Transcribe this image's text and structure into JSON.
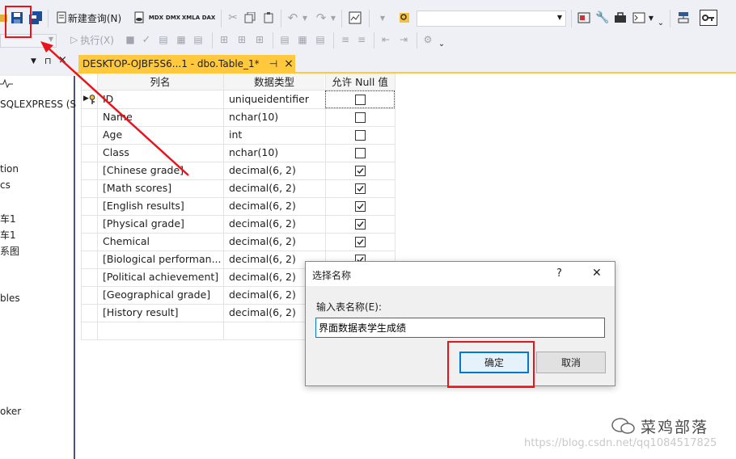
{
  "toolbar": {
    "new_query_label": "新建查询(N)",
    "mdx_label": "MDX",
    "dmx_label": "DMX",
    "xmla_label": "XMLA",
    "dax_label": "DAX",
    "execute_label": "执行(X)"
  },
  "left_panel": {
    "items": [
      "SQLEXPRESS (S",
      "tion",
      "cs",
      "车1",
      "车1",
      "系图",
      "bles",
      "oker"
    ]
  },
  "document_tab": {
    "title": "DESKTOP-OJBF5S6...1 - dbo.Table_1*",
    "pin": "⊣",
    "close": "×"
  },
  "table_designer": {
    "headers": [
      "列名",
      "数据类型",
      "允许 Null 值"
    ],
    "rows": [
      {
        "name": "ID",
        "type": "uniqueidentifier",
        "allow_null": false,
        "primary_key": true
      },
      {
        "name": "Name",
        "type": "nchar(10)",
        "allow_null": false
      },
      {
        "name": "Age",
        "type": "int",
        "allow_null": false
      },
      {
        "name": "Class",
        "type": "nchar(10)",
        "allow_null": false
      },
      {
        "name": "[Chinese grade]",
        "type": "decimal(6, 2)",
        "allow_null": true
      },
      {
        "name": "[Math scores]",
        "type": "decimal(6, 2)",
        "allow_null": true
      },
      {
        "name": "[English results]",
        "type": "decimal(6, 2)",
        "allow_null": true
      },
      {
        "name": "[Physical grade]",
        "type": "decimal(6, 2)",
        "allow_null": true
      },
      {
        "name": "Chemical",
        "type": "decimal(6, 2)",
        "allow_null": true
      },
      {
        "name": "[Biological performan...",
        "type": "decimal(6, 2)",
        "allow_null": true
      },
      {
        "name": "[Political achievement]",
        "type": "decimal(6, 2)",
        "allow_null": true
      },
      {
        "name": "[Geographical grade]",
        "type": "decimal(6, 2)",
        "allow_null": true
      },
      {
        "name": "[History result]",
        "type": "decimal(6, 2)",
        "allow_null": true
      }
    ]
  },
  "dialog": {
    "title": "选择名称",
    "help": "?",
    "close": "✕",
    "prompt": "输入表名称(E):",
    "input_value": "界面数据表学生成绩",
    "ok_label": "确定",
    "cancel_label": "取消"
  },
  "watermark": {
    "brand": "菜鸡部落",
    "url": "https://blog.csdn.net/qq1084517825"
  },
  "colors": {
    "accent_tab": "#ffc83d",
    "annotation_red": "#e8141c",
    "panel_border": "#4a5677"
  }
}
